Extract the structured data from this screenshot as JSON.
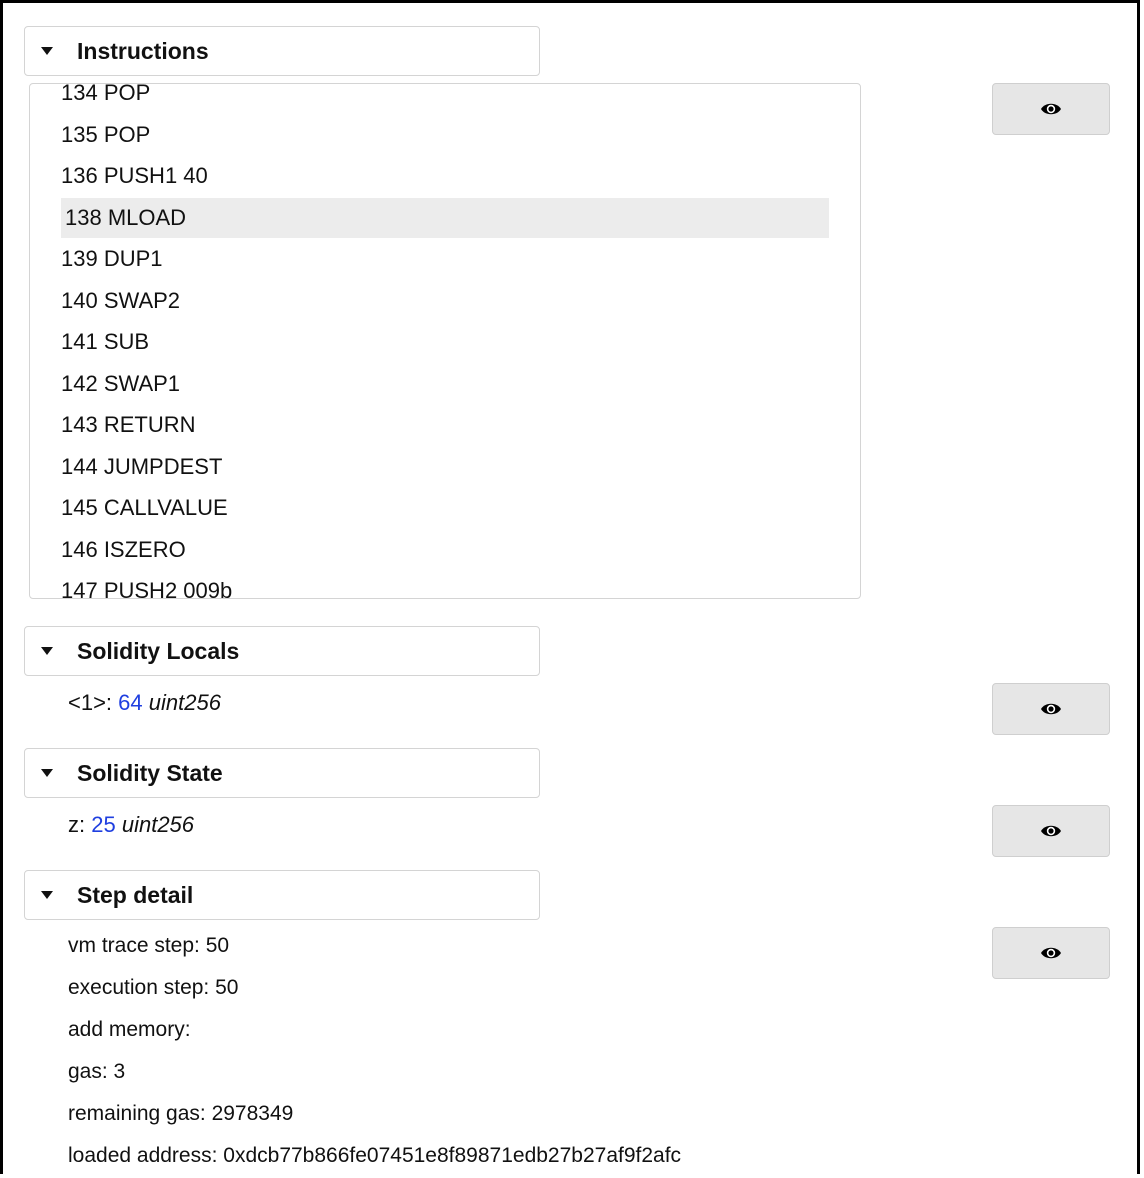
{
  "sections": {
    "instructions": {
      "title": "Instructions",
      "items": [
        "134 POP",
        "135 POP",
        "136 PUSH1 40",
        "138 MLOAD",
        "139 DUP1",
        "140 SWAP2",
        "141 SUB",
        "142 SWAP1",
        "143 RETURN",
        "144 JUMPDEST",
        "145 CALLVALUE",
        "146 ISZERO",
        "147 PUSH2 009b"
      ],
      "selected_item": "138 MLOAD"
    },
    "locals": {
      "title": "Solidity Locals",
      "entry": {
        "key": "<1>: ",
        "value": "64",
        "type": "uint256"
      }
    },
    "state": {
      "title": "Solidity State",
      "entry": {
        "key": "z: ",
        "value": "25",
        "type": "uint256"
      }
    },
    "step_detail": {
      "title": "Step detail",
      "lines": [
        "vm trace step: 50",
        "execution step: 50",
        "add memory:",
        "gas: 3",
        "remaining gas: 2978349",
        "loaded address: 0xdcb77b866fe07451e8f89871edb27b27af9f2afc"
      ]
    }
  },
  "icons": {
    "caret": "caret-down-icon",
    "eye": "eye-icon"
  },
  "colors": {
    "value_blue": "#1f3fe0",
    "selected_row": "#ececec",
    "button_bg": "#e6e6e6"
  }
}
